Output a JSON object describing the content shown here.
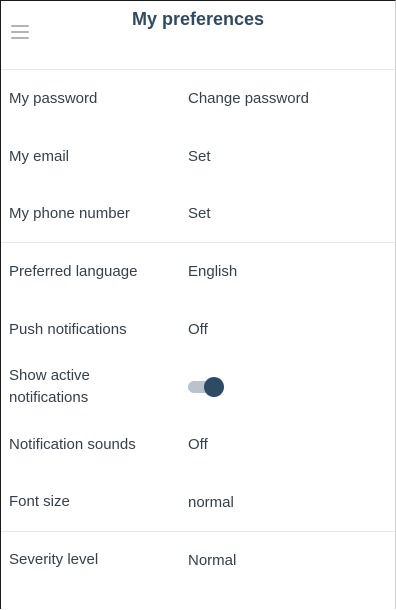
{
  "header": {
    "title": "My preferences",
    "menu_icon": "hamburger-menu-icon"
  },
  "preferences": [
    {
      "label": "My password",
      "value": "Change password"
    },
    {
      "label": "My email",
      "value": "Set"
    },
    {
      "label": "My phone number",
      "value": "Set"
    },
    {
      "label": "Preferred language",
      "value": "English"
    },
    {
      "label": "Push notifications",
      "value": "Off"
    },
    {
      "label": "Show active\nnotifications",
      "toggle_on": true
    },
    {
      "label": "Notification sounds",
      "value": "Off"
    },
    {
      "label": "Font size",
      "value": "normal"
    },
    {
      "label": "Severity level",
      "value": "Normal"
    }
  ],
  "colors": {
    "title": "#2f4a63",
    "text": "#35404a",
    "toggle_track": "#b9c3cd",
    "toggle_knob": "#2d4a66",
    "divider": "#e6e9ec"
  }
}
